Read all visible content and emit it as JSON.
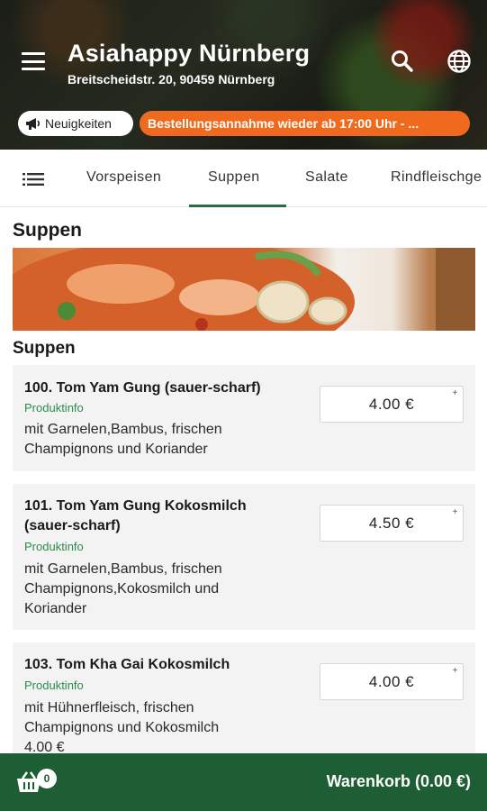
{
  "header": {
    "title": "Asiahappy Nürnberg",
    "address": "Breitscheidstr. 20, 90459 Nürnberg",
    "news_label": "Neuigkeiten",
    "notice": "Bestellungsannahme wieder ab 17:00 Uhr - ..."
  },
  "tabs": {
    "items": [
      "Vorspeisen",
      "Suppen",
      "Salate",
      "Rindfleischge"
    ],
    "active": "Suppen"
  },
  "category": {
    "title": "Suppen",
    "subtitle": "Suppen"
  },
  "products": [
    {
      "name": "100. Tom Yam Gung (sauer-scharf)",
      "info_link": "Produktinfo",
      "description": "mit Garnelen,Bambus, frischen Champignons und Koriander",
      "price": "4.00 €"
    },
    {
      "name": "101. Tom Yam Gung Kokosmilch (sauer-scharf)",
      "info_link": "Produktinfo",
      "description": "mit Garnelen,Bambus, frischen Champignons,Kokosmilch und Koriander",
      "price": "4.50 €"
    },
    {
      "name": "103. Tom Kha Gai Kokosmilch",
      "info_link": "Produktinfo",
      "description": "mit Hühnerfleisch, frischen Champignons und Kokosmilch",
      "price": "4.00 €",
      "extra": "4.00 €"
    }
  ],
  "cart": {
    "count": "0",
    "label": "Warenkorb (0.00 €)"
  },
  "colors": {
    "accent_green": "#1e5e34",
    "info_green": "#2d8a4e",
    "notice_orange": "#ef6a1f"
  },
  "icons": [
    "menu-icon",
    "search-icon",
    "globe-icon",
    "megaphone-icon",
    "list-icon",
    "basket-icon"
  ]
}
